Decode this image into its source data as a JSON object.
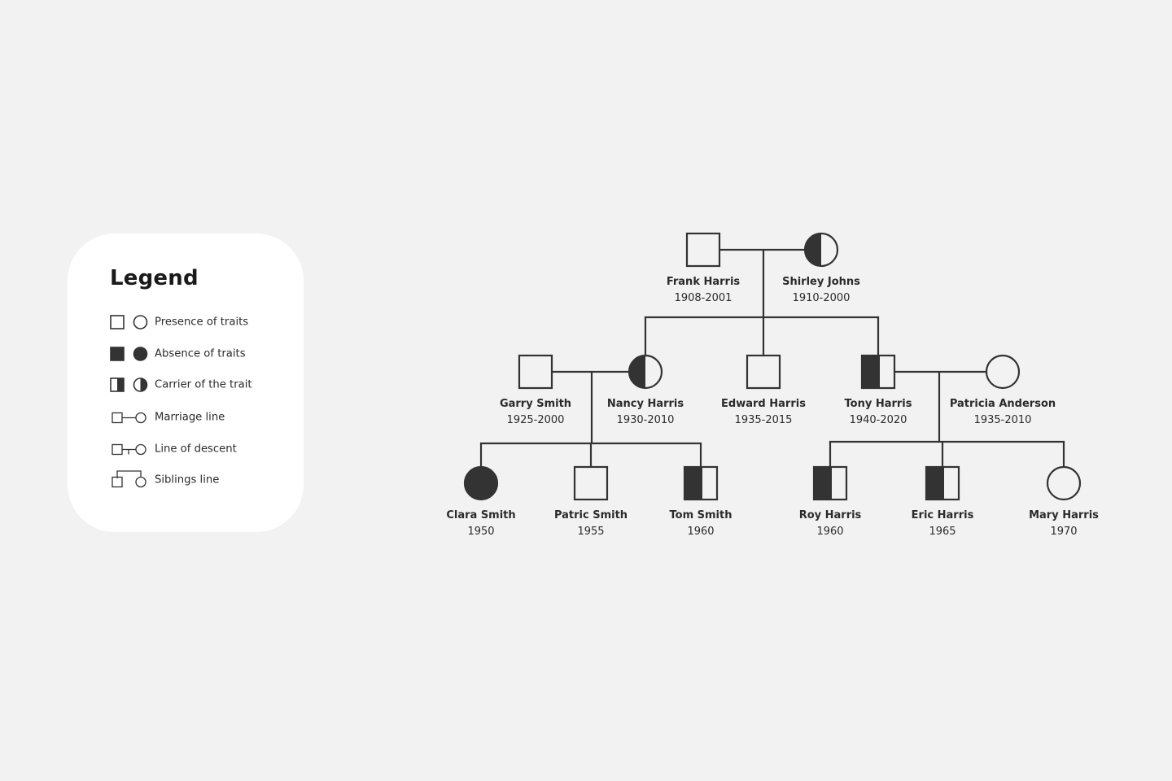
{
  "colors": {
    "background": "#f2f2f2",
    "panel": "#ffffff",
    "ink": "#333333",
    "text": "#2b2b2b"
  },
  "legend": {
    "title": "Legend",
    "items": [
      {
        "symbol": "presence",
        "label": "Presence of traits"
      },
      {
        "symbol": "absence",
        "label": "Absence of traits"
      },
      {
        "symbol": "carrier",
        "label": "Carrier of the trait"
      },
      {
        "symbol": "marriage-line",
        "label": "Marriage line"
      },
      {
        "symbol": "descent-line",
        "label": "Line of descent"
      },
      {
        "symbol": "siblings-line",
        "label": "Siblings line"
      }
    ]
  },
  "people": [
    {
      "id": "frank",
      "name": "Frank Harris",
      "years": "1908-2001",
      "sex": "male",
      "status": "presence",
      "generation": 1
    },
    {
      "id": "shirley",
      "name": "Shirley Johns",
      "years": "1910-2000",
      "sex": "female",
      "status": "carrier",
      "generation": 1
    },
    {
      "id": "garry",
      "name": "Garry Smith",
      "years": "1925-2000",
      "sex": "male",
      "status": "presence",
      "generation": 2
    },
    {
      "id": "nancy",
      "name": "Nancy Harris",
      "years": "1930-2010",
      "sex": "female",
      "status": "carrier",
      "generation": 2
    },
    {
      "id": "edward",
      "name": "Edward Harris",
      "years": "1935-2015",
      "sex": "male",
      "status": "presence",
      "generation": 2
    },
    {
      "id": "tony",
      "name": "Tony Harris",
      "years": "1940-2020",
      "sex": "male",
      "status": "carrier",
      "generation": 2
    },
    {
      "id": "patricia",
      "name": "Patricia Anderson",
      "years": "1935-2010",
      "sex": "female",
      "status": "presence",
      "generation": 2
    },
    {
      "id": "clara",
      "name": "Clara Smith",
      "years": "1950",
      "sex": "female",
      "status": "absence",
      "generation": 3
    },
    {
      "id": "patric",
      "name": "Patric Smith",
      "years": "1955",
      "sex": "male",
      "status": "presence",
      "generation": 3
    },
    {
      "id": "tom",
      "name": "Tom Smith",
      "years": "1960",
      "sex": "male",
      "status": "carrier",
      "generation": 3
    },
    {
      "id": "roy",
      "name": "Roy Harris",
      "years": "1960",
      "sex": "male",
      "status": "carrier",
      "generation": 3
    },
    {
      "id": "eric",
      "name": "Eric Harris",
      "years": "1965",
      "sex": "male",
      "status": "carrier",
      "generation": 3
    },
    {
      "id": "mary",
      "name": "Mary Harris",
      "years": "1970",
      "sex": "female",
      "status": "presence",
      "generation": 3
    }
  ],
  "marriages": [
    {
      "partners": [
        "frank",
        "shirley"
      ],
      "children": [
        "nancy",
        "edward",
        "tony"
      ]
    },
    {
      "partners": [
        "garry",
        "nancy"
      ],
      "children": [
        "clara",
        "patric",
        "tom"
      ]
    },
    {
      "partners": [
        "tony",
        "patricia"
      ],
      "children": [
        "roy",
        "eric",
        "mary"
      ]
    }
  ]
}
